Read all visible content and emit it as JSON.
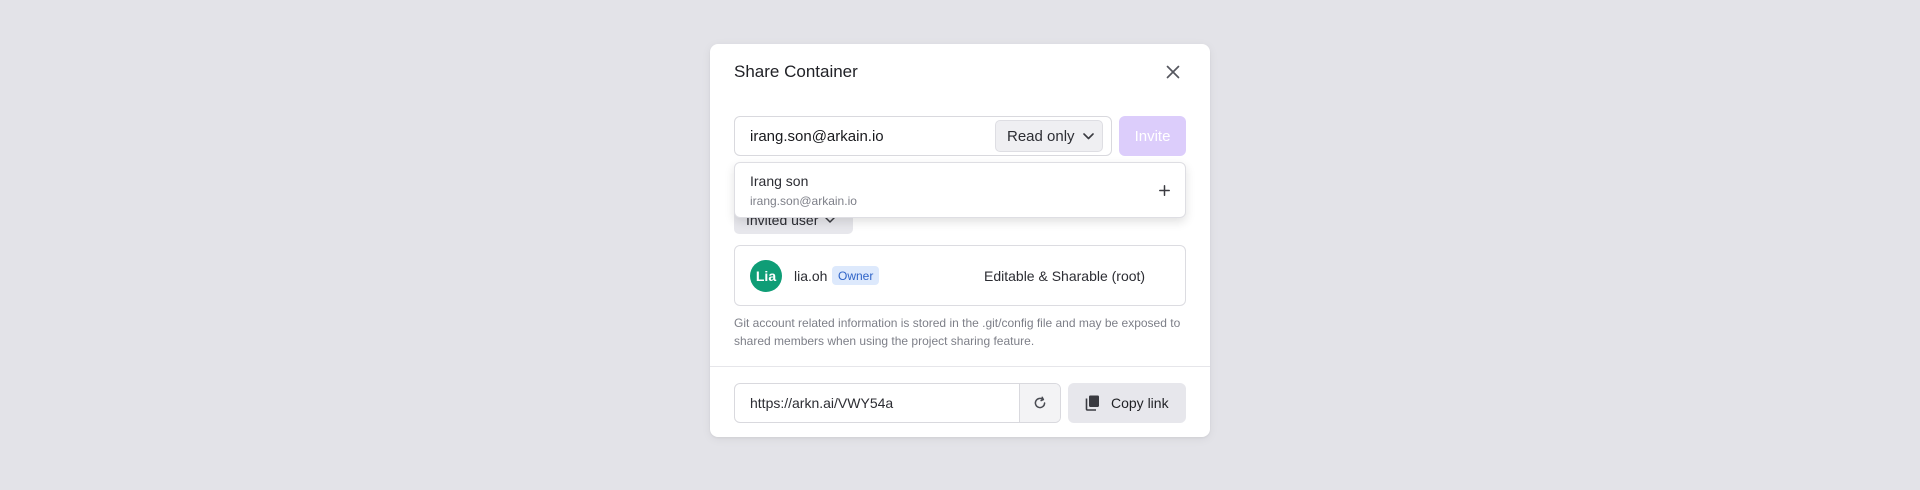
{
  "dialog": {
    "title": "Share Container",
    "close_icon": "close-icon"
  },
  "invite": {
    "email_value": "irang.son@arkain.io",
    "permission_selected": "Read only",
    "invite_label": "Invite",
    "invite_enabled": false
  },
  "suggestion": {
    "name": "Irang son",
    "email": "irang.son@arkain.io",
    "add_icon": "plus-icon"
  },
  "members": {
    "filter_label": "Invited user",
    "items": [
      {
        "initials": "Lia",
        "name": "lia.oh",
        "badge": "Owner",
        "permission": "Editable & Sharable (root)"
      }
    ]
  },
  "notice": "Git account related information is stored in the .git/config file and may be exposed to shared members when using the project sharing feature.",
  "link": {
    "url": "https://arkn.ai/VWY54a",
    "refresh_icon": "refresh-icon",
    "copy_label": "Copy link",
    "copy_icon": "copy-icon"
  },
  "colors": {
    "backdrop": "#e3e3e8",
    "invite_disabled": "#dccdfb",
    "avatar": "#0f9d76",
    "owner_badge_bg": "#dde9fc",
    "owner_badge_text": "#2f64c8"
  }
}
